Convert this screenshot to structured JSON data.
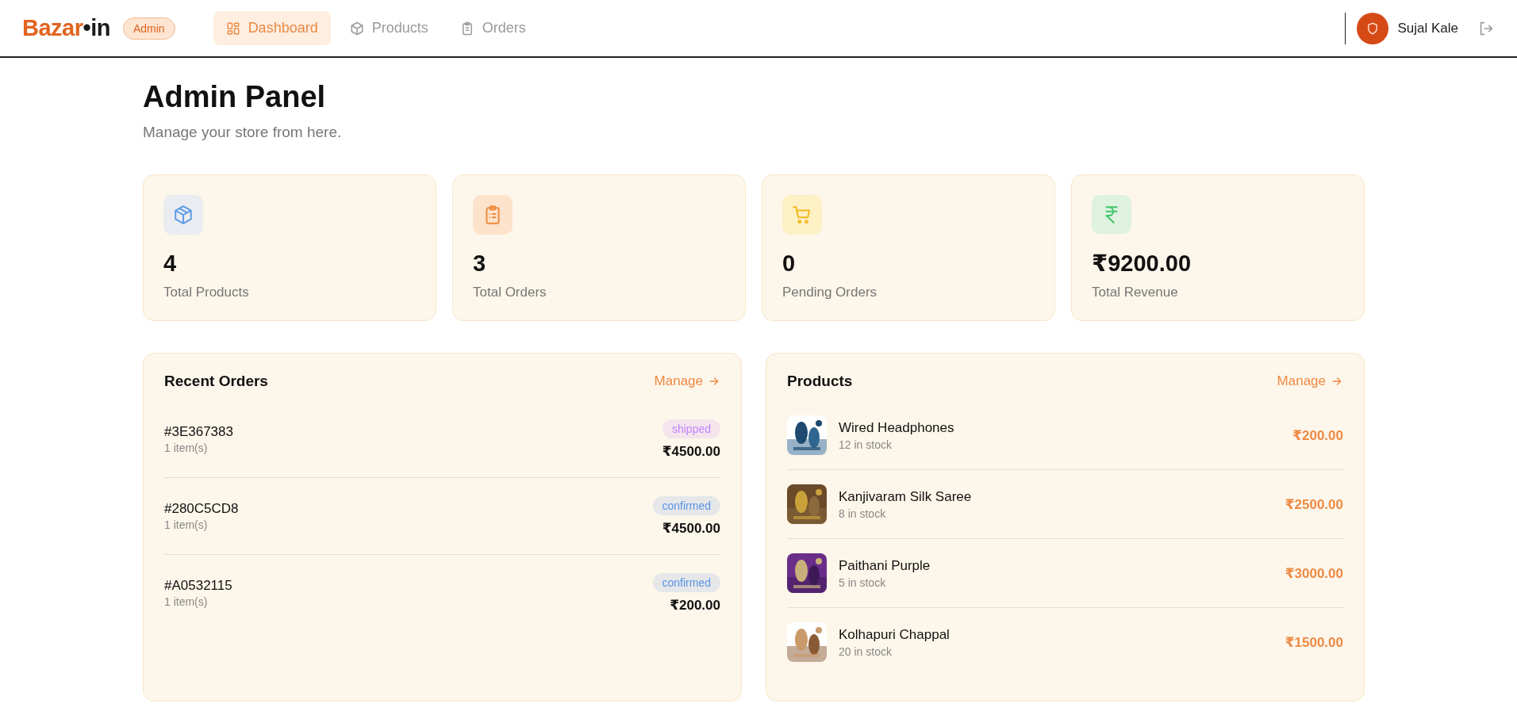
{
  "header": {
    "logo": {
      "main": "Bazar",
      "dot": "•",
      "suffix": "in"
    },
    "badge": "Admin",
    "nav": [
      {
        "label": "Dashboard",
        "kind": "grid",
        "selected": true
      },
      {
        "label": "Products",
        "kind": "box",
        "selected": false
      },
      {
        "label": "Orders",
        "kind": "clipboard",
        "selected": false
      }
    ],
    "user": {
      "name": "Sujal Kale"
    }
  },
  "page": {
    "title": "Admin Panel",
    "subtitle": "Manage your store from here."
  },
  "stats": [
    {
      "kind": "box",
      "value": "4",
      "label": "Total Products"
    },
    {
      "kind": "clipboard",
      "value": "3",
      "label": "Total Orders"
    },
    {
      "kind": "cart",
      "value": "0",
      "label": "Pending Orders"
    },
    {
      "kind": "rupee",
      "value": "₹9200.00",
      "label": "Total Revenue"
    }
  ],
  "recent_orders": {
    "title": "Recent Orders",
    "link": "Manage",
    "orders": [
      {
        "id": "#3E367383",
        "items": "1 item(s)",
        "status": "shipped",
        "color": "#c084fc",
        "total": "₹4500.00"
      },
      {
        "id": "#280C5CD8",
        "items": "1 item(s)",
        "status": "confirmed",
        "color": "#5b93e6",
        "total": "₹4500.00"
      },
      {
        "id": "#A0532115",
        "items": "1 item(s)",
        "status": "confirmed",
        "color": "#5b93e6",
        "total": "₹200.00"
      }
    ]
  },
  "products": {
    "title": "Products",
    "link": "Manage",
    "items": [
      {
        "name": "Wired Headphones",
        "stock": "12 in stock",
        "price": "₹200.00",
        "kind": "picture"
      },
      {
        "name": "Kanjivaram Silk Saree",
        "stock": "8 in stock",
        "price": "₹2500.00",
        "kind": "picture"
      },
      {
        "name": "Paithani Purple",
        "stock": "5 in stock",
        "price": "₹3000.00",
        "kind": "picture"
      },
      {
        "name": "Kolhapuri Chappal",
        "stock": "20 in stock",
        "price": "₹1500.00",
        "kind": "picture"
      }
    ]
  }
}
